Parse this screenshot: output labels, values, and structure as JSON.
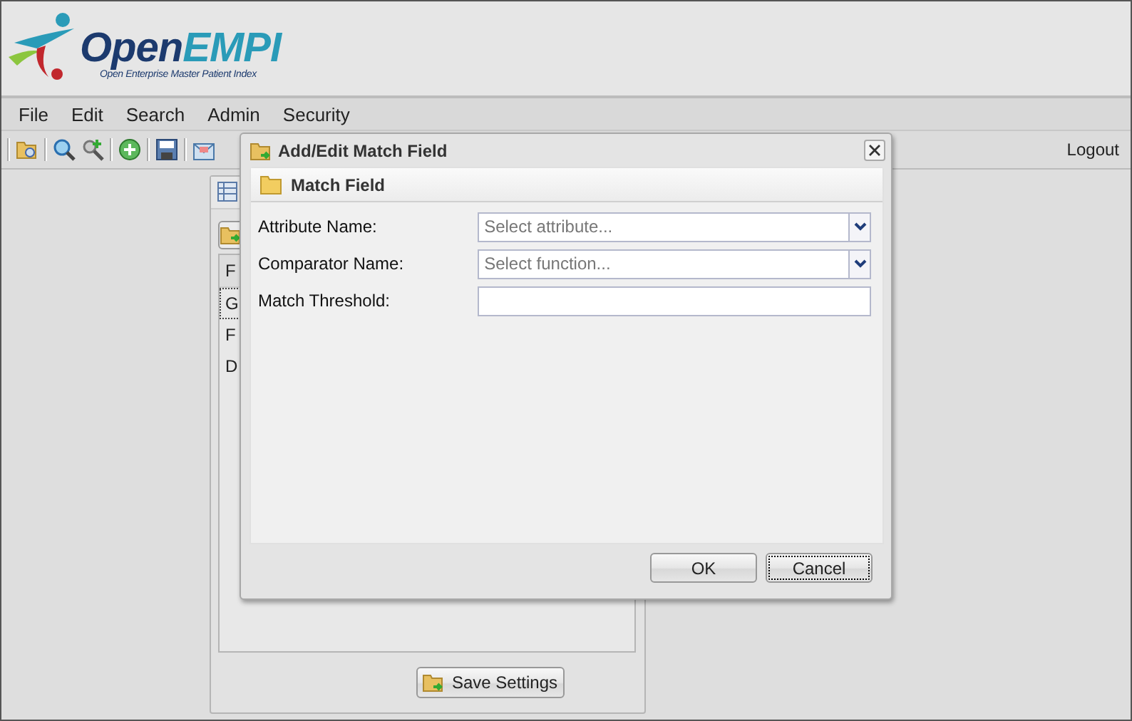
{
  "logo": {
    "wordmark": [
      "Open",
      "EMPI"
    ],
    "tagline": "Open Enterprise Master Patient Index"
  },
  "menu": [
    {
      "label": "File"
    },
    {
      "label": "Edit"
    },
    {
      "label": "Search"
    },
    {
      "label": "Admin"
    },
    {
      "label": "Security"
    }
  ],
  "toolbar": {
    "logout": "Logout"
  },
  "background_panel": {
    "grid_header": "F",
    "rows": [
      "G",
      "F",
      "D"
    ],
    "save_button": "Save Settings"
  },
  "dialog": {
    "title": "Add/Edit Match Field",
    "section": "Match Field",
    "fields": [
      {
        "kind": "select",
        "label": "Attribute Name:",
        "placeholder": "Select attribute..."
      },
      {
        "kind": "select",
        "label": "Comparator Name:",
        "placeholder": "Select function..."
      },
      {
        "kind": "text",
        "label": "Match Threshold:"
      }
    ],
    "buttons": [
      {
        "label": "OK",
        "focused": false
      },
      {
        "label": "Cancel",
        "focused": true
      }
    ]
  }
}
